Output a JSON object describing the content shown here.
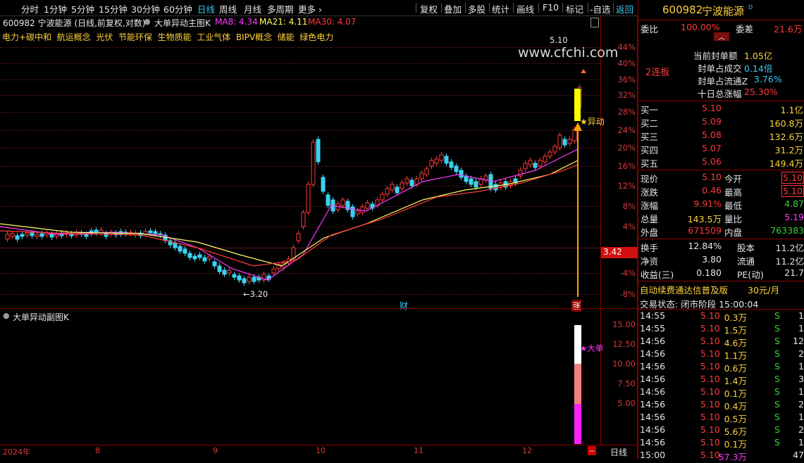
{
  "toolbar": {
    "periods": [
      "分时",
      "1分钟",
      "5分钟",
      "15分钟",
      "30分钟",
      "60分钟",
      "日线",
      "周线",
      "月线",
      "多周期",
      "更多 ›"
    ],
    "active_period": "日线",
    "right_items": [
      "复权",
      "叠加",
      "多股",
      "统计",
      "画线",
      "F10",
      "标记",
      "-自选",
      "返回"
    ]
  },
  "chart": {
    "title": "600982 宁波能源 (日线,前复权,对数)",
    "indicator_main": "大单异动主图K",
    "ma": [
      {
        "label": "MA8: 4.34",
        "color": "#ff3aff"
      },
      {
        "label": "MA21: 4.11",
        "color": "#ffff66"
      },
      {
        "label": "MA30: 4.07",
        "color": "#ff3a3a"
      }
    ],
    "concepts": "电力+碳中和  航运概念  光伏  节能环保  生物质能  工业气体  BIPV概念  储能  绿色电力",
    "y_axis": [
      "44%",
      "40%",
      "36%",
      "32%",
      "28%",
      "24%",
      "20%",
      "16%",
      "12%",
      "8%",
      "4%",
      "-4%",
      "-8%"
    ],
    "price_tag": "3.42",
    "high_label": "5.10",
    "low_label": "←3.20",
    "watermark": "www.cfchi.com",
    "yidong_label": "★异动",
    "cai_label": "财",
    "zhang_label": "涨",
    "sub_title": "大单异动副图K",
    "sub_axis": [
      "15.00",
      "12.50",
      "10.00",
      "7.50",
      "5.00"
    ],
    "sub_star": "★大单",
    "x_axis": [
      "2024年",
      "8",
      "9",
      "10",
      "11",
      "12"
    ],
    "bottom_tab": "日线",
    "bottom_dash": "--"
  },
  "panel": {
    "code": "600982",
    "name": "宁波能源",
    "weibi_label": "委比",
    "weibi_val": "100.00%",
    "weicha_label": "委差",
    "weicha_val": "21.6万",
    "lianban": "2连板",
    "seal_stats": [
      {
        "label": "当前封单额",
        "value": "1.05亿"
      },
      {
        "label": "封单占成交",
        "value": "0.14倍"
      },
      {
        "label": "封单占流通Z",
        "value": "3.76%"
      },
      {
        "label": "十日总涨幅",
        "value": "25.30%"
      }
    ],
    "bids": [
      {
        "label": "买一",
        "price": "5.10",
        "vol": "1.1亿"
      },
      {
        "label": "买二",
        "price": "5.09",
        "vol": "160.8万"
      },
      {
        "label": "买三",
        "price": "5.08",
        "vol": "132.6万"
      },
      {
        "label": "买四",
        "price": "5.07",
        "vol": "31.2万"
      },
      {
        "label": "买五",
        "price": "5.06",
        "vol": "149.4万"
      }
    ],
    "quote": [
      {
        "l1": "现价",
        "v1": "5.10",
        "l2": "今开",
        "v2": "5.10"
      },
      {
        "l1": "涨跌",
        "v1": "0.46",
        "l2": "最高",
        "v2": "5.10"
      },
      {
        "l1": "涨幅",
        "v1": "9.91%",
        "l2": "最低",
        "v2": "4.87"
      },
      {
        "l1": "总量",
        "v1": "143.5万",
        "l2": "量比",
        "v2": "5.19"
      },
      {
        "l1": "外盘",
        "v1": "671509",
        "l2": "内盘",
        "v2": "763383"
      }
    ],
    "finance": [
      {
        "l1": "换手",
        "v1": "12.84%",
        "l2": "股本",
        "v2": "11.2亿"
      },
      {
        "l1": "净资",
        "v1": "3.80",
        "l2": "流通",
        "v2": "11.2亿"
      },
      {
        "l1": "收益(三)",
        "v1": "0.180",
        "l2": "PE(动)",
        "v2": "21.7"
      }
    ],
    "ad_text": "自动续费通达信普及版",
    "ad_price": "30元/月",
    "trade_status": "交易状态: 闭市阶段 15:00:04",
    "ticks": [
      {
        "t": "14:55",
        "p": "5.10",
        "v": "0.3万",
        "s": "S",
        "n": "1"
      },
      {
        "t": "14:55",
        "p": "5.10",
        "v": "1.5万",
        "s": "S",
        "n": "1"
      },
      {
        "t": "14:56",
        "p": "5.10",
        "v": "4.6万",
        "s": "S",
        "n": "12"
      },
      {
        "t": "14:56",
        "p": "5.10",
        "v": "1.1万",
        "s": "S",
        "n": "2"
      },
      {
        "t": "14:56",
        "p": "5.10",
        "v": "0.6万",
        "s": "S",
        "n": "1"
      },
      {
        "t": "14:56",
        "p": "5.10",
        "v": "1.4万",
        "s": "S",
        "n": "3"
      },
      {
        "t": "14:56",
        "p": "5.10",
        "v": "0.1万",
        "s": "S",
        "n": "1"
      },
      {
        "t": "14:56",
        "p": "5.10",
        "v": "0.4万",
        "s": "S",
        "n": "2"
      },
      {
        "t": "14:56",
        "p": "5.10",
        "v": "0.5万",
        "s": "S",
        "n": "1"
      },
      {
        "t": "14:56",
        "p": "5.10",
        "v": "5.6万",
        "s": "S",
        "n": "2"
      },
      {
        "t": "14:56",
        "p": "5.10",
        "v": "0.1万",
        "s": "S",
        "n": "1"
      },
      {
        "t": "15:00",
        "p": "5.10",
        "v": "57.3万",
        "s": "",
        "n": "47"
      }
    ]
  }
}
